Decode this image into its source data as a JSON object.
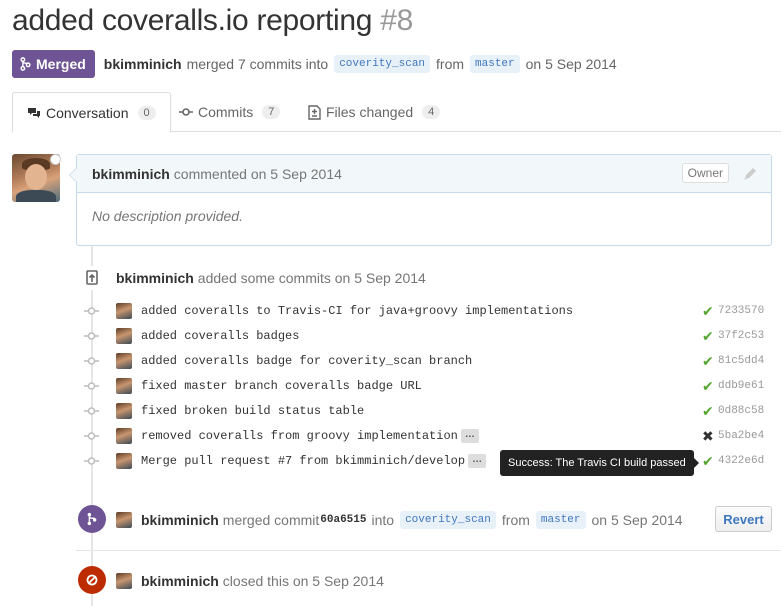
{
  "pr": {
    "title": "added coveralls.io reporting",
    "number": "#8",
    "state_label": "Merged",
    "author": "bkimminich",
    "summary_mid": "merged 7 commits into",
    "base_branch": "coverity_scan",
    "from_text": "from",
    "head_branch": "master",
    "date_text": "on 5 Sep 2014"
  },
  "tabs": [
    {
      "label": "Conversation",
      "count": "0"
    },
    {
      "label": "Commits",
      "count": "7"
    },
    {
      "label": "Files changed",
      "count": "4"
    }
  ],
  "comment": {
    "author": "bkimminich",
    "meta": "commented on 5 Sep 2014",
    "owner_label": "Owner",
    "body": "No description provided."
  },
  "push_event": {
    "author": "bkimminich",
    "text": "added some commits on 5 Sep 2014"
  },
  "commits": [
    {
      "message": "added coveralls to Travis-CI for java+groovy implementations",
      "status": "success",
      "sha": "7233570",
      "ellipsis": false
    },
    {
      "message": "added coveralls badges",
      "status": "success",
      "sha": "37f2c53",
      "ellipsis": false
    },
    {
      "message": "added coveralls badge for coverity_scan branch",
      "status": "success",
      "sha": "81c5dd4",
      "ellipsis": false
    },
    {
      "message": "fixed master branch coveralls badge URL",
      "status": "success",
      "sha": "ddb9e61",
      "ellipsis": false
    },
    {
      "message": "fixed broken build status table",
      "status": "success",
      "sha": "0d88c58",
      "ellipsis": false
    },
    {
      "message": "removed coveralls from groovy implementation",
      "status": "failure",
      "sha": "5ba2be4",
      "ellipsis": true
    },
    {
      "message": "Merge pull request #7 from bkimminich/develop",
      "status": "success",
      "sha": "4322e6d",
      "ellipsis": true
    }
  ],
  "status_icons": {
    "success": "✔",
    "failure": "✖"
  },
  "ellipsis_label": "…",
  "tooltip": "Success: The Travis CI build passed",
  "merge_event": {
    "author": "bkimminich",
    "text1": "merged commit",
    "commit": "60a6515",
    "text2": "into",
    "base_branch": "coverity_scan",
    "from_text": "from",
    "head_branch": "master",
    "date_text": "on 5 Sep 2014",
    "revert_label": "Revert"
  },
  "close_event": {
    "author": "bkimminich",
    "text": "closed this on 5 Sep 2014"
  },
  "colors": {
    "merged": "#6e5494",
    "closed": "#bd2c00",
    "success": "#55a532",
    "link": "#4078c0"
  }
}
